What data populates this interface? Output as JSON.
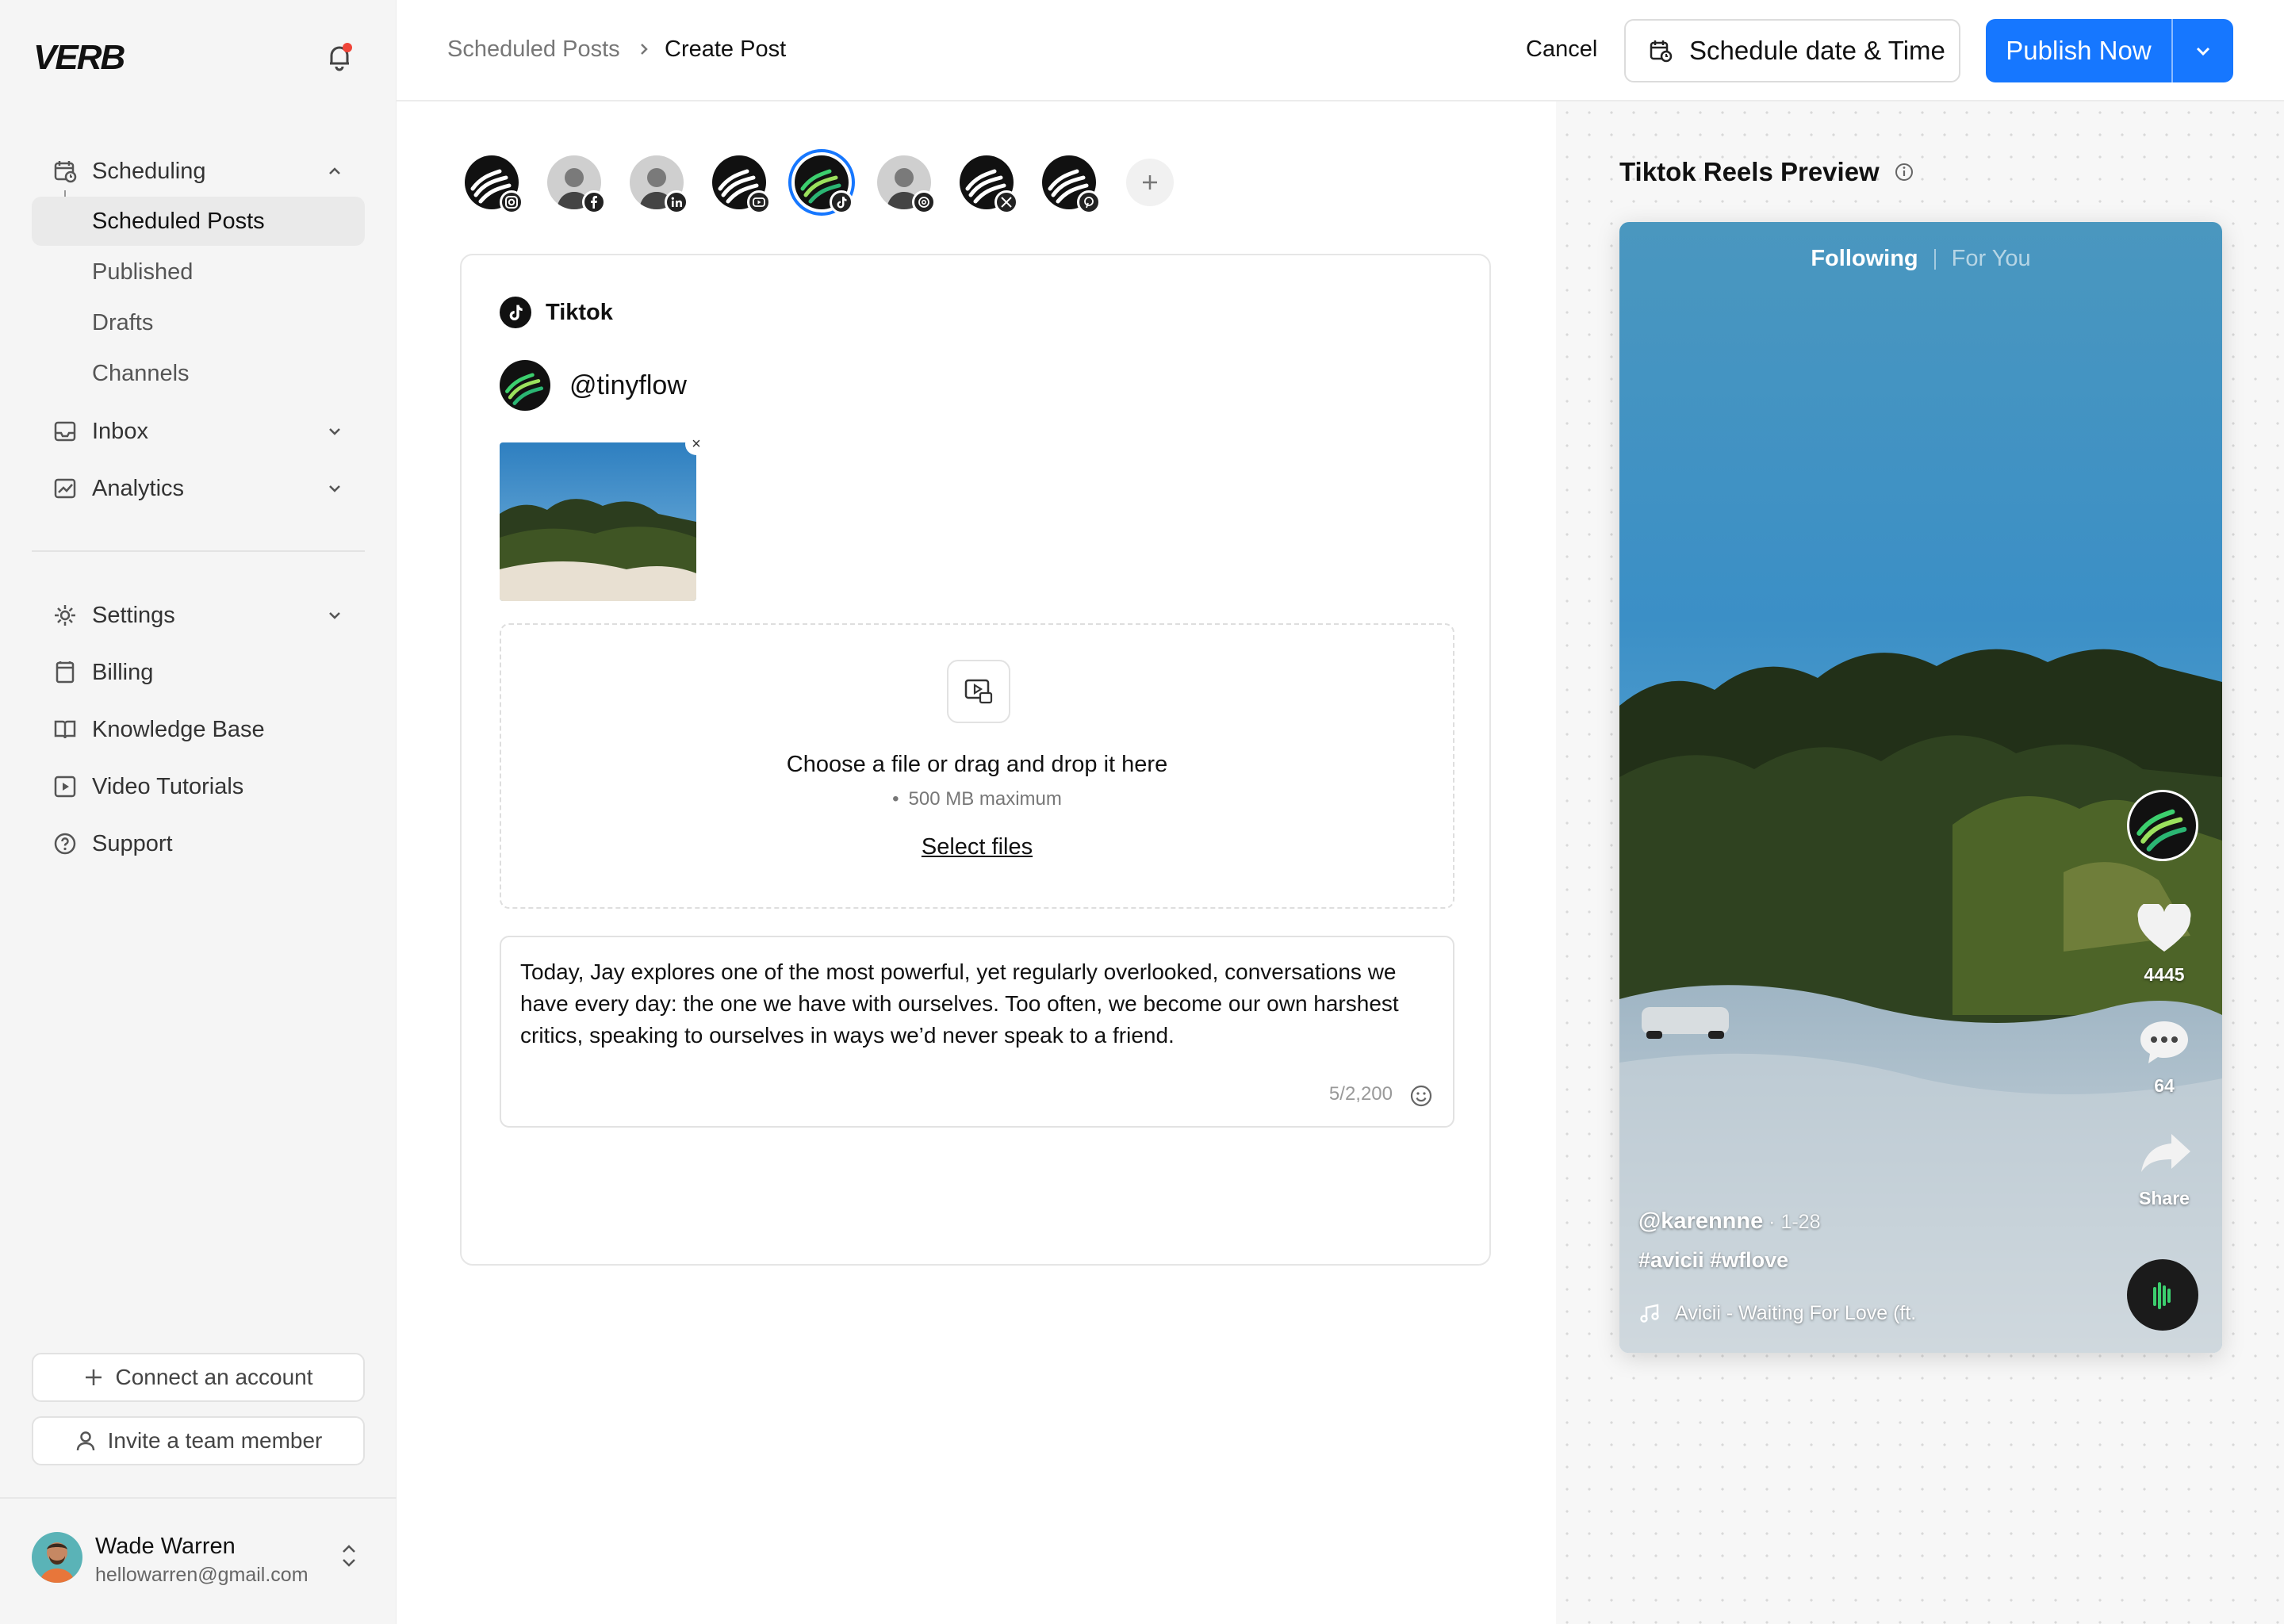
{
  "sidebar": {
    "logo": "VERB",
    "nav": [
      {
        "label": "Scheduling",
        "icon": "calendar-clock-icon"
      },
      {
        "label": "Inbox",
        "icon": "inbox-icon"
      },
      {
        "label": "Analytics",
        "icon": "chart-icon"
      }
    ],
    "scheduling_sub": [
      "Scheduled Posts",
      "Published",
      "Drafts",
      "Channels"
    ],
    "secondary": [
      {
        "label": "Settings",
        "icon": "gear-icon"
      },
      {
        "label": "Billing",
        "icon": "billing-icon"
      },
      {
        "label": "Knowledge Base",
        "icon": "book-icon"
      },
      {
        "label": "Video Tutorials",
        "icon": "play-icon"
      },
      {
        "label": "Support",
        "icon": "help-icon"
      }
    ],
    "connect_label": "Connect an account",
    "invite_label": "Invite a team member",
    "user": {
      "name": "Wade Warren",
      "email": "hellowarren@gmail.com"
    }
  },
  "header": {
    "breadcrumb": [
      "Scheduled Posts",
      "Create Post"
    ],
    "cancel": "Cancel",
    "schedule": "Schedule date & Time",
    "publish": "Publish Now"
  },
  "composer": {
    "network": "Tiktok",
    "handle": "@tinyflow",
    "dropzone": {
      "title": "Choose a file or drag and drop it here",
      "limit": "500 MB maximum",
      "link": "Select files"
    },
    "caption": "Today, Jay explores one of the most powerful, yet regularly overlooked, conversations we have every day: the one we have with ourselves. Too often, we become our own harshest critics, speaking to ourselves in ways we’d never speak to a friend.",
    "count": "5/2,200"
  },
  "accounts": [
    {
      "platform": "instagram",
      "selected": false
    },
    {
      "platform": "facebook",
      "selected": false
    },
    {
      "platform": "linkedin",
      "selected": false
    },
    {
      "platform": "youtube",
      "selected": false
    },
    {
      "platform": "tiktok",
      "selected": true
    },
    {
      "platform": "threads",
      "selected": false
    },
    {
      "platform": "x",
      "selected": false
    },
    {
      "platform": "pinterest",
      "selected": false
    }
  ],
  "preview": {
    "title": "Tiktok Reels Preview",
    "tab_following": "Following",
    "tab_foryou": "For You",
    "likes": "4445",
    "comments": "64",
    "share": "Share",
    "user": "@karennne",
    "date": " · 1-28",
    "tags": "#avicii #wflove",
    "music": "Avicii - Waiting For Love (ft."
  },
  "colors": {
    "accent": "#1677ff",
    "sidebar_bg": "#f5f5f5",
    "notification": "#f04438"
  }
}
